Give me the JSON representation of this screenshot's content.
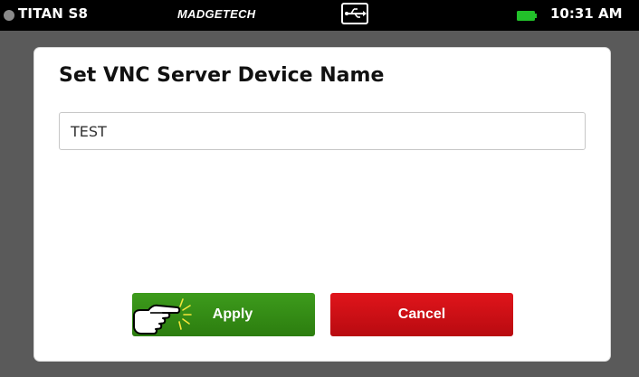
{
  "status_bar": {
    "device_name": "TITAN S8",
    "brand": "MADGETECH",
    "usb_icon": "usb-icon",
    "battery_icon": "battery-icon",
    "battery_color": "#22c12a",
    "time": "10:31 AM"
  },
  "dialog": {
    "title": "Set VNC Server Device Name",
    "input": {
      "value": "TEST"
    },
    "buttons": {
      "apply_label": "Apply",
      "cancel_label": "Cancel",
      "apply_color": "#2f8a14",
      "cancel_color": "#c8101a"
    },
    "pointer_icon": "pointing-hand-icon"
  }
}
